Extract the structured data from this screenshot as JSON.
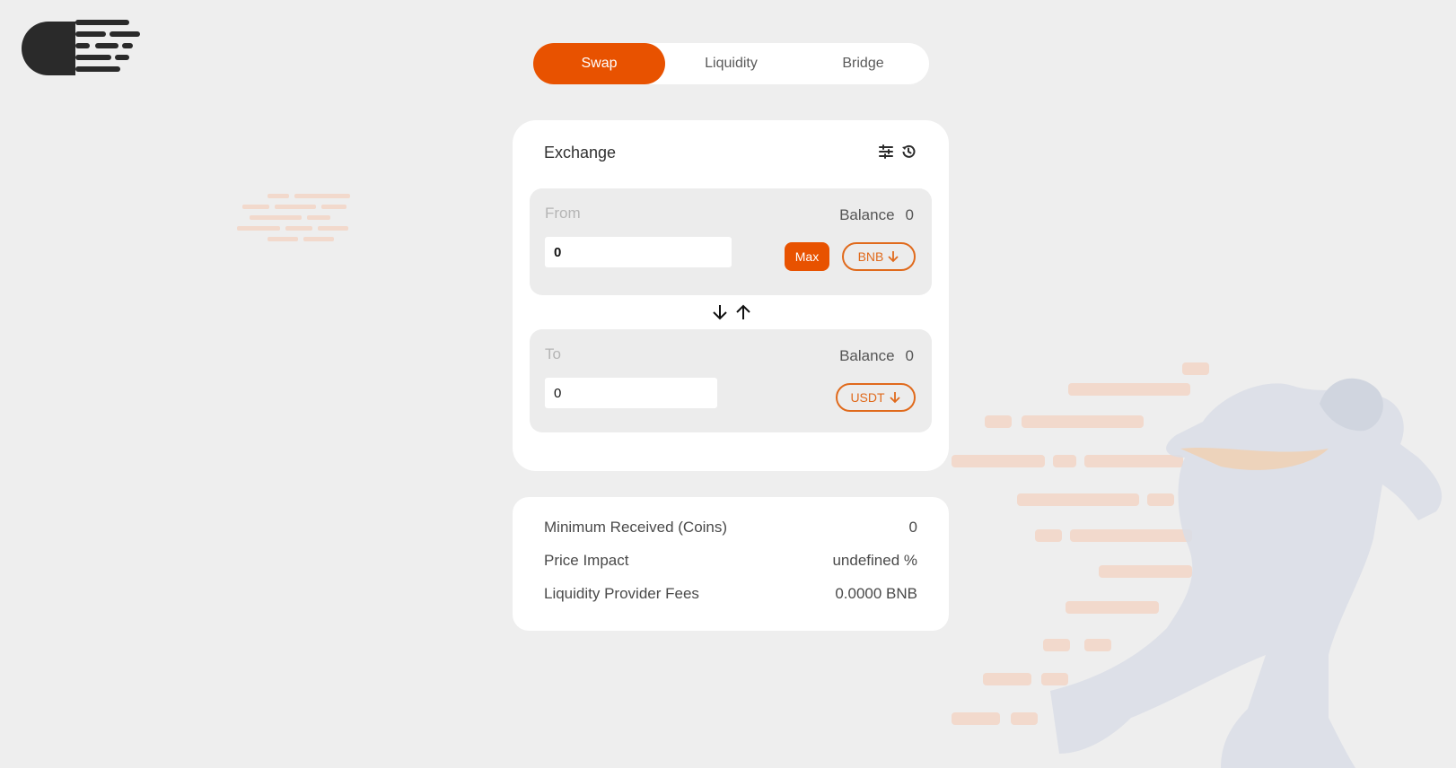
{
  "colors": {
    "accent": "#e85200",
    "background": "#eeeeee",
    "card": "#ffffff",
    "panel": "#ececec"
  },
  "logo": {
    "icon": "speed-lines-logo-icon"
  },
  "tabs": [
    {
      "label": "Swap",
      "active": true
    },
    {
      "label": "Liquidity",
      "active": false
    },
    {
      "label": "Bridge",
      "active": false
    }
  ],
  "exchange": {
    "title": "Exchange",
    "settings_icon": "sliders-icon",
    "history_icon": "history-icon",
    "from": {
      "label": "From",
      "balance_label": "Balance",
      "balance_value": "0",
      "amount": "0",
      "max_label": "Max",
      "token": "BNB"
    },
    "swap_icon": "swap-arrows-icon",
    "to": {
      "label": "To",
      "balance_label": "Balance",
      "balance_value": "0",
      "amount": "0",
      "token": "USDT"
    }
  },
  "details": {
    "rows": [
      {
        "label": "Minimum Received (Coins)",
        "value": "0"
      },
      {
        "label": "Price Impact",
        "value": "undefined %"
      },
      {
        "label": "Liquidity Provider Fees",
        "value": "0.0000 BNB"
      }
    ]
  },
  "background_art": {
    "icon": "running-businessman-illustration"
  }
}
